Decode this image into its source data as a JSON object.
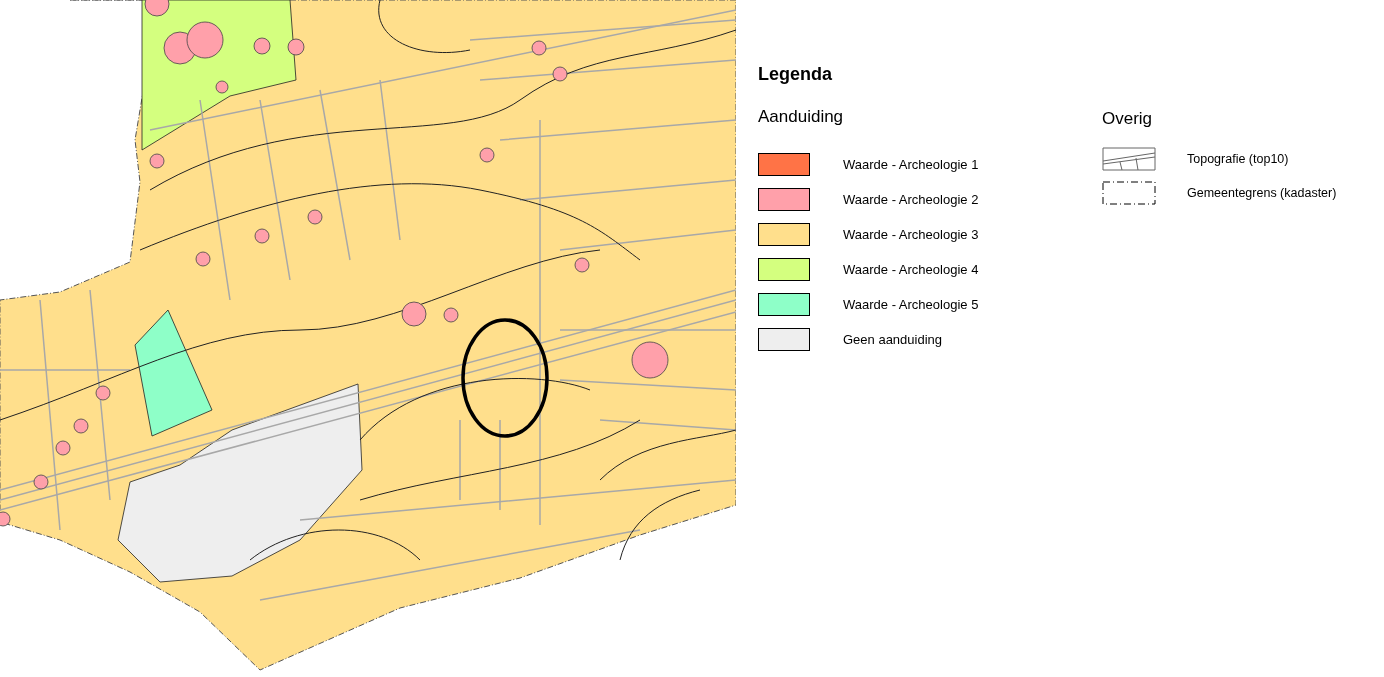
{
  "legend": {
    "title": "Legenda",
    "sections": [
      {
        "heading": "Aanduiding",
        "items": [
          {
            "kind": "fill",
            "label": "Waarde - Archeologie 1",
            "color": "#ff7346"
          },
          {
            "kind": "fill",
            "label": "Waarde - Archeologie 2",
            "color": "#ffa0aa"
          },
          {
            "kind": "fill",
            "label": "Waarde - Archeologie 3",
            "color": "#ffdf8c"
          },
          {
            "kind": "fill",
            "label": "Waarde - Archeologie 4",
            "color": "#d4ff7f"
          },
          {
            "kind": "fill",
            "label": "Waarde - Archeologie 5",
            "color": "#8effc8"
          },
          {
            "kind": "fill",
            "label": "Geen aanduiding",
            "color": "#eeeeee"
          }
        ]
      },
      {
        "heading": "Overig",
        "items": [
          {
            "kind": "topography",
            "label": "Topografie (top10)"
          },
          {
            "kind": "boundary",
            "label": "Gemeentegrens (kadaster)"
          }
        ]
      }
    ]
  }
}
